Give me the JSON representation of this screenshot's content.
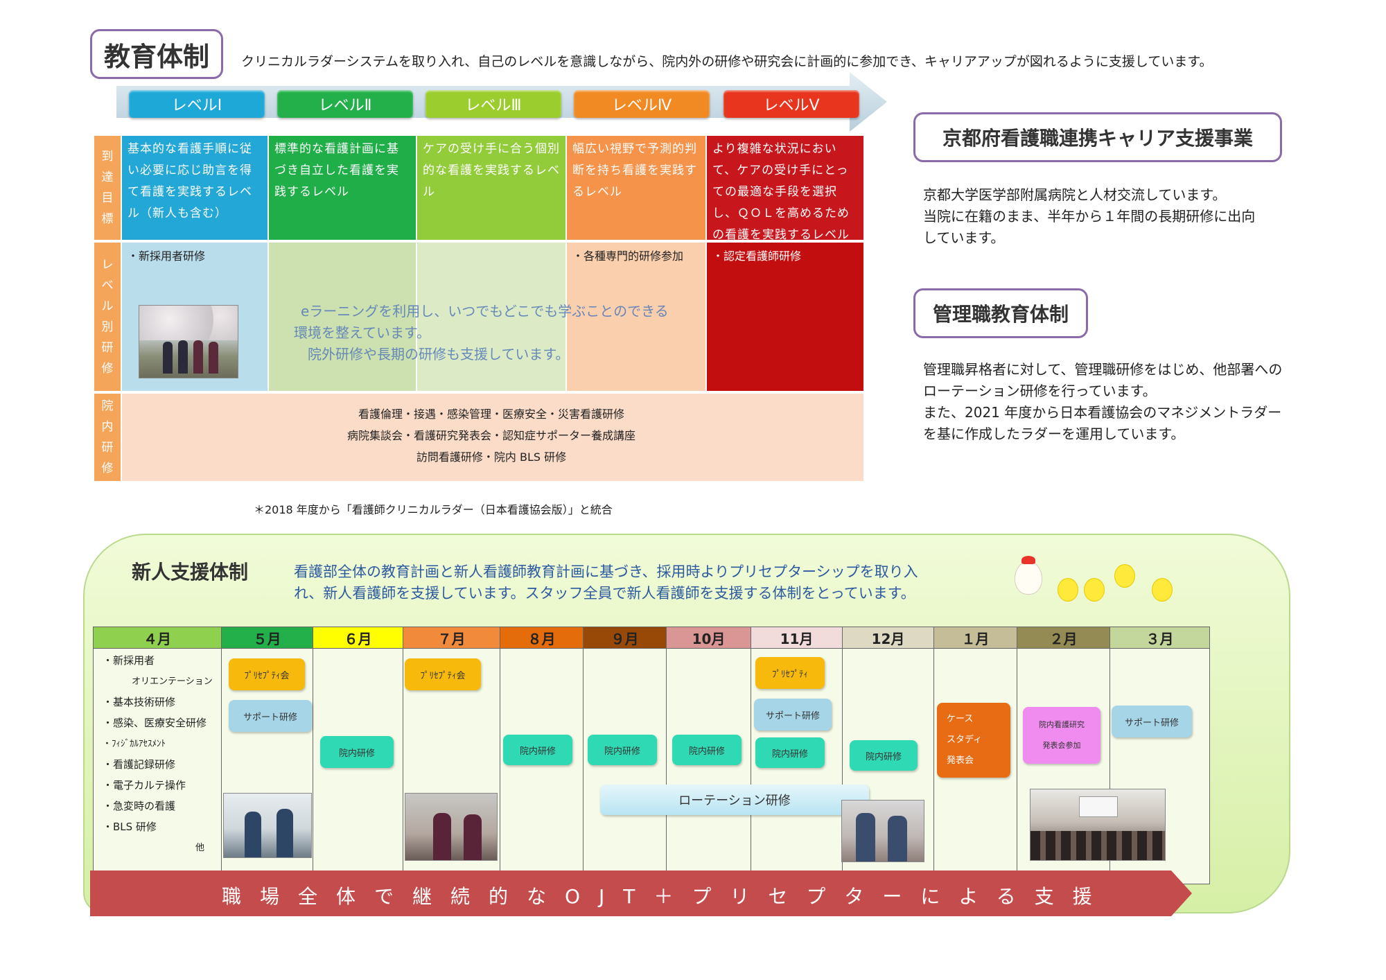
{
  "education": {
    "title": "教育体制",
    "description": "クリニカルラダーシステムを取り入れ、自己のレベルを意識しながら、院内外の研修や研究会に計画的に参加でき、キャリアアップが図れるように支援しています。",
    "levels": [
      {
        "label": "レベルⅠ",
        "color": "#1ea8d8"
      },
      {
        "label": "レベルⅡ",
        "color": "#23b04a"
      },
      {
        "label": "レベルⅢ",
        "color": "#9ccd2e"
      },
      {
        "label": "レベルⅣ",
        "color": "#f28a23"
      },
      {
        "label": "レベルⅤ",
        "color": "#e8351e"
      }
    ],
    "row_labels": {
      "goal": [
        "到",
        "達",
        "目",
        "標"
      ],
      "level_training": [
        "レ",
        "ベ",
        "ル",
        "別",
        "研",
        "修"
      ],
      "in_hospital": [
        "院",
        "内",
        "研",
        "修"
      ]
    },
    "goals": [
      "基本的な看護手順に従い必要に応じ助言を得て看護を実践するレベル（新人も含む）",
      "標準的な看護計画に基づき自立した看護を実践するレベル",
      "ケアの受け手に合う個別的な看護を実践するレベル",
      "幅広い視野で予測的判断を持ち看護を実践するレベル",
      "より複雑な状況において、ケアの受け手にとっての最適な手段を選択し、ＱＯＬを高めるための看護を実践するレベル"
    ],
    "level_trainings": {
      "level1": "・新採用者研修",
      "level4": "・各種専門的研修参加",
      "level5": "・認定看護師研修"
    },
    "elearning": [
      "eラーニングを利用し、いつでもどこでも学ぶことのできる",
      "環境を整えています。",
      "院外研修や長期の研修も支援しています。"
    ],
    "in_hospital_training": [
      "看護倫理・接遇・感染管理・医療安全・災害看護研修",
      "病院集談会・看護研究発表会・認知症サポーター養成講座",
      "訪問看護研修・院内 BLS 研修"
    ],
    "note": "＊2018 年度から「看護師クリニカルラダー（日本看護協会版）」と統合"
  },
  "kyoto": {
    "title": "京都府看護職連携キャリア支援事業",
    "lines": [
      "京都大学医学部附属病院と人材交流しています。",
      "当院に在籍のまま、半年から１年間の長期研修に出向",
      "しています。"
    ]
  },
  "management": {
    "title": "管理職教育体制",
    "lines": [
      "管理職昇格者に対して、管理職研修をはじめ、他部署への",
      "ローテーション研修を行っています。",
      "また、2021 年度から日本看護協会のマネジメントラダー",
      "を基に作成したラダーを運用しています。"
    ]
  },
  "newcomer": {
    "title": "新人支援体制",
    "description_lines": [
      "看護部全体の教育計画と新人看護師教育計画に基づき、採用時よりプリセプターシップを取り入",
      "れ、新人看護師を支援しています。スタッフ全員で新人看護師を支援する体制をとっています。"
    ],
    "months": [
      {
        "label": "４月",
        "color": "#8fd14f"
      },
      {
        "label": "５月",
        "color": "#23b04a"
      },
      {
        "label": "６月",
        "color": "#ffff00"
      },
      {
        "label": "７月",
        "color": "#f28a3c"
      },
      {
        "label": "８月",
        "color": "#e46c0a"
      },
      {
        "label": "９月",
        "color": "#984807"
      },
      {
        "label": "10月",
        "color": "#d99694"
      },
      {
        "label": "11月",
        "color": "#f2dcdb"
      },
      {
        "label": "12月",
        "color": "#ddd9c3"
      },
      {
        "label": "１月",
        "color": "#c4bd97"
      },
      {
        "label": "２月",
        "color": "#948a54"
      },
      {
        "label": "３月",
        "color": "#c3d69b"
      }
    ],
    "april_items": [
      "・新採用者",
      "オリエンテーション",
      "・基本技術研修",
      "・感染、医療安全研修",
      "・ﾌｨｼﾞｶﾙｱｾｽﾒﾝﾄ",
      "・看護記録研修",
      "・電子カルテ操作",
      "・急変時の看護",
      "・BLS 研修",
      "他"
    ],
    "events": {
      "precepti_may": "ﾌﾟﾘｾﾌﾟﾃｨ会",
      "support_may": "サポート研修",
      "innai_jun": "院内研修",
      "precepti_jul": "ﾌﾟﾘｾﾌﾟﾃｨ会",
      "innai_aug": "院内研修",
      "innai_sep": "院内研修",
      "innai_oct": "院内研修",
      "precepti_nov": "ﾌﾟﾘｾﾌﾟﾃｨ",
      "support_nov": "サポート研修",
      "innai_nov": "院内研修",
      "innai_dec": "院内研修",
      "case_study": [
        "ケース",
        "スタディ",
        "発表会"
      ],
      "research_feb": [
        "院内看護研究",
        "発表会参加"
      ],
      "support_mar": "サポート研修",
      "rotation": "ローテーション研修"
    },
    "ojt_banner": "職場全体で継続的なOJT＋プリセプターによる支援"
  }
}
